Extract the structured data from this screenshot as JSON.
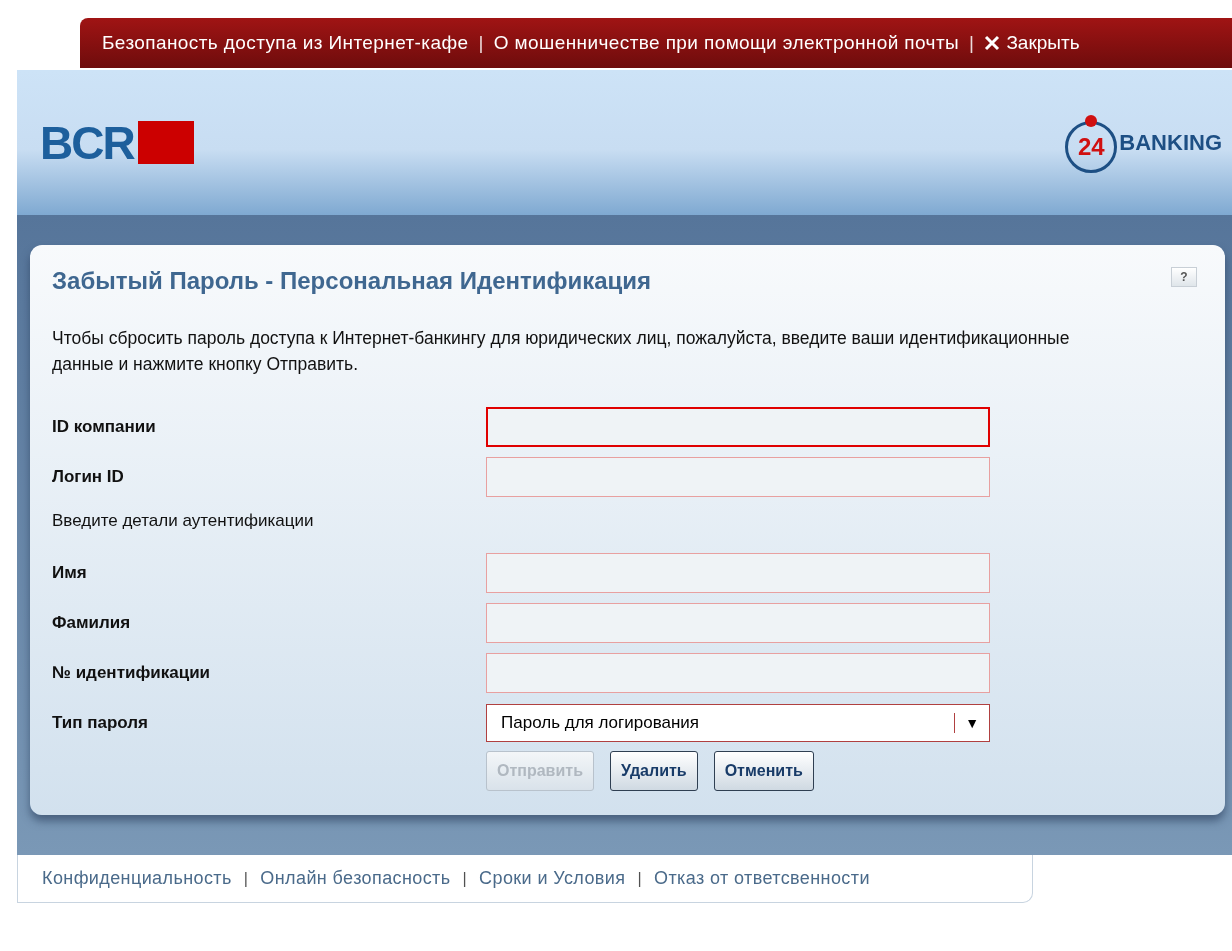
{
  "top_bar": {
    "items": [
      {
        "kind": "link",
        "label": "Безопаность доступа из Интернет-кафе"
      },
      {
        "kind": "separator",
        "label": "|"
      },
      {
        "kind": "link",
        "label": "О мошенничестве при помощи электронной почты"
      },
      {
        "kind": "separator",
        "label": "|"
      },
      {
        "kind": "close",
        "label": "Закрыть"
      }
    ]
  },
  "header": {
    "logo": "BCR",
    "badge_number": "24",
    "badge_text": "BANKING"
  },
  "card": {
    "title": "Забытый Пароль - Персональная Идентификация",
    "help": "?",
    "intro": "Чтобы сбросить пароль доступа к Интернет-банкингу для юридических лиц, пожалуйста, введите ваши идентификационные данные и нажмите кнопку Отправить.",
    "rows": [
      {
        "kind": "text",
        "label": "ID компании",
        "focused": true
      },
      {
        "kind": "text",
        "label": "Логин ID",
        "focused": false
      },
      {
        "kind": "note",
        "label": "Введите детали аутентификации"
      },
      {
        "kind": "text",
        "label": "Имя",
        "focused": false
      },
      {
        "kind": "text",
        "label": "Фамилия",
        "focused": false
      },
      {
        "kind": "text",
        "label": "№ идентификации",
        "focused": false
      },
      {
        "kind": "select",
        "label": "Тип пароля",
        "value": "Пароль для логирования",
        "caret": "▼"
      }
    ],
    "buttons": [
      {
        "label": "Отправить",
        "disabled": true
      },
      {
        "label": "Удалить",
        "disabled": false
      },
      {
        "label": "Отменить",
        "disabled": false
      }
    ]
  },
  "footer": {
    "items": [
      {
        "kind": "link",
        "label": "Конфиденциальность"
      },
      {
        "kind": "separator",
        "label": "|"
      },
      {
        "kind": "link",
        "label": "Онлайн безопасность"
      },
      {
        "kind": "separator",
        "label": "|"
      },
      {
        "kind": "link",
        "label": "Сроки и Условия"
      },
      {
        "kind": "separator",
        "label": "|"
      },
      {
        "kind": "link",
        "label": "Отказ от ответсвенности"
      }
    ]
  }
}
